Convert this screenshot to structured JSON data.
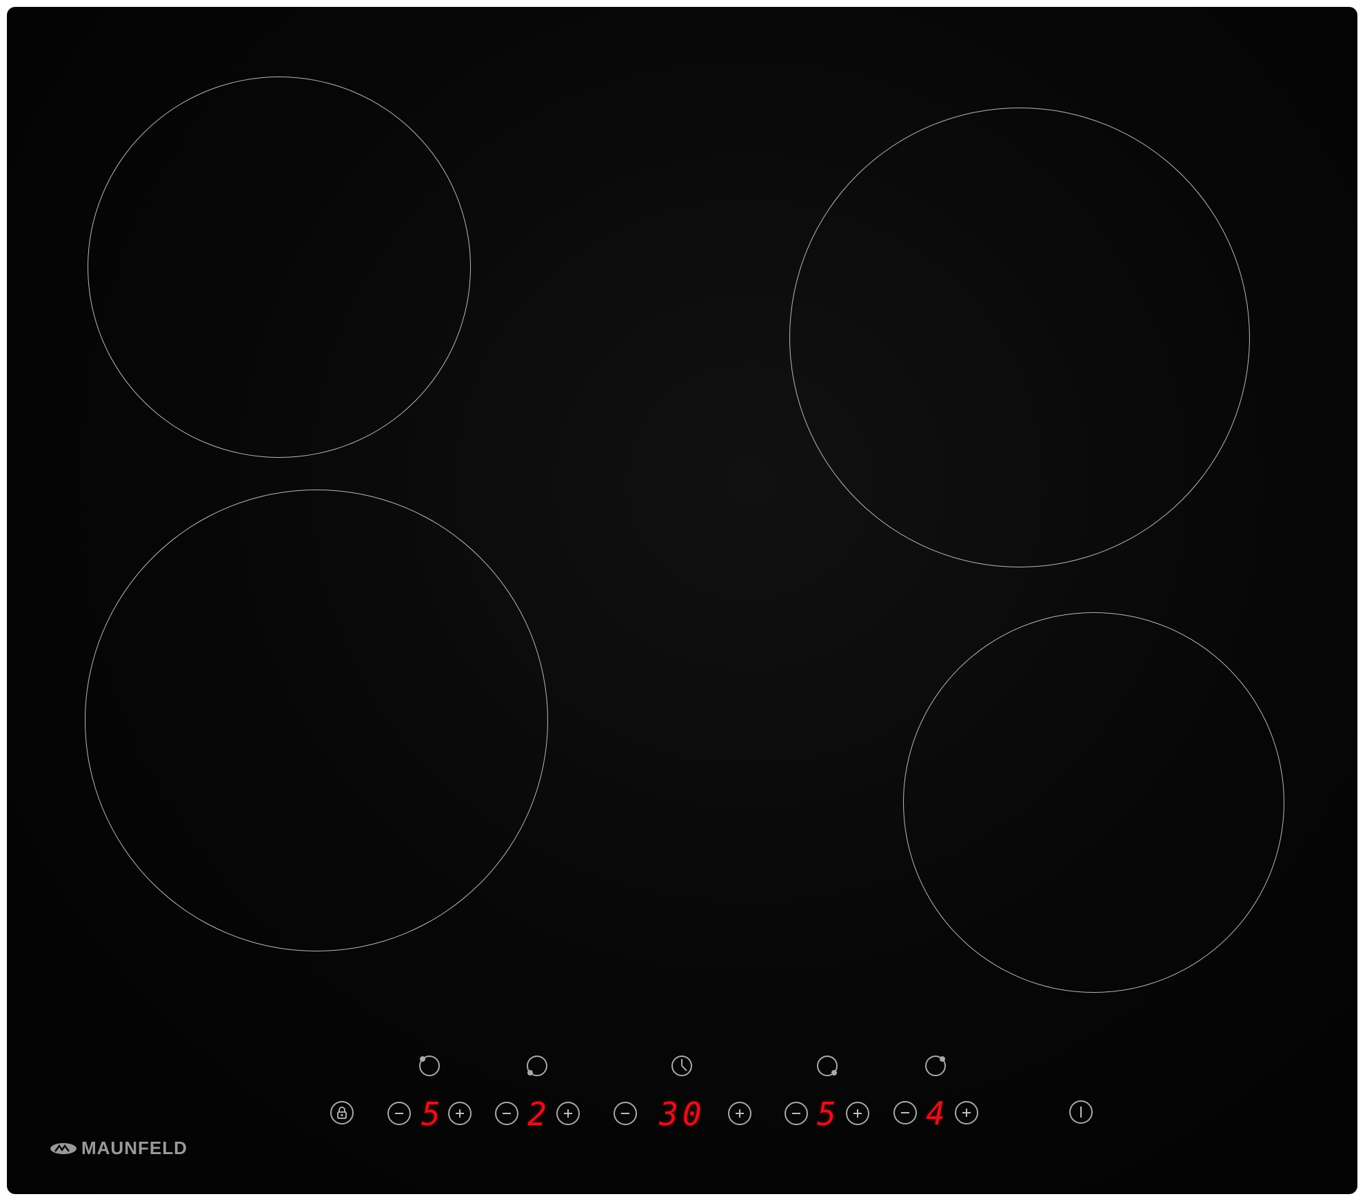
{
  "brand": {
    "name": "MAUNFELD",
    "color": "#9a9a9a"
  },
  "panel": {
    "glass_color": "#050505",
    "zone_outline_color": "#b8b8b8",
    "display_color": "#e4101c"
  },
  "zones": [
    {
      "id": "rear-left",
      "icon": "zone-rear-left-icon",
      "level": "5"
    },
    {
      "id": "front-left",
      "icon": "zone-front-left-icon",
      "level": "2"
    },
    {
      "id": "front-right",
      "icon": "zone-front-right-icon",
      "level": "5"
    },
    {
      "id": "rear-right",
      "icon": "zone-rear-right-icon",
      "level": "4"
    }
  ],
  "timer": {
    "icon": "clock-icon",
    "value": "30"
  },
  "controls": {
    "lock_icon": "lock-icon",
    "minus_icon": "minus-icon",
    "plus_icon": "plus-icon",
    "power_icon": "power-icon"
  }
}
